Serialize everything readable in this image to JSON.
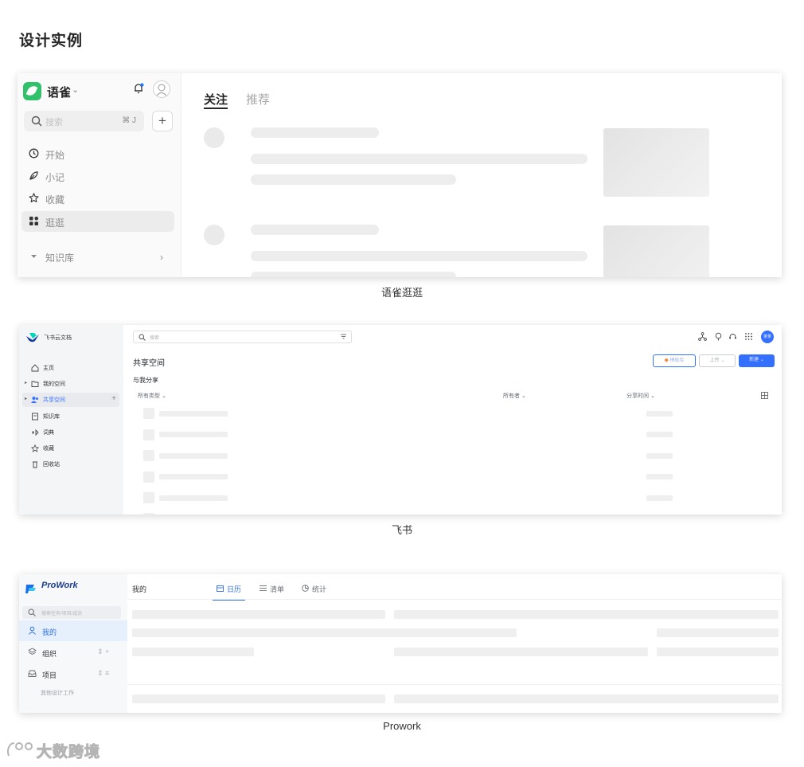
{
  "page": {
    "heading": "设计实例"
  },
  "yuque": {
    "brand": "语雀",
    "search_placeholder": "搜索",
    "search_shortcut": "⌘ J",
    "nav": [
      {
        "label": "开始",
        "icon": "clock-icon"
      },
      {
        "label": "小记",
        "icon": "feather-icon"
      },
      {
        "label": "收藏",
        "icon": "star-icon"
      },
      {
        "label": "逛逛",
        "icon": "grid-icon",
        "active": true
      }
    ],
    "section": "知识库",
    "tabs": [
      {
        "label": "关注",
        "active": true
      },
      {
        "label": "推荐"
      }
    ],
    "caption": "语雀逛逛"
  },
  "feishu": {
    "brand": "飞书云文档",
    "search_placeholder": "搜索",
    "nav": [
      {
        "label": "主页",
        "icon": "home-icon"
      },
      {
        "label": "我的空间",
        "icon": "folder-icon"
      },
      {
        "label": "共享空间",
        "icon": "users-icon",
        "active": true
      },
      {
        "label": "知识库",
        "icon": "book-icon"
      },
      {
        "label": "词典",
        "icon": "dictionary-icon"
      },
      {
        "label": "收藏",
        "icon": "star-icon"
      },
      {
        "label": "回收站",
        "icon": "trash-icon"
      }
    ],
    "page_title": "共享空间",
    "section_title": "与我分享",
    "buttons": {
      "template": "模板库",
      "upload": "上传",
      "create": "新建"
    },
    "columns": {
      "type": "所有类型",
      "owner": "所有者",
      "time": "分享时间"
    },
    "avatar_text": "茶茶",
    "caption": "飞书"
  },
  "prowork": {
    "brand": "ProWork",
    "search_placeholder": "搜索任务/项目/成员",
    "nav": [
      {
        "label": "我的",
        "icon": "user-icon",
        "active": true
      },
      {
        "label": "组织",
        "icon": "layers-icon",
        "tools": "⇕  +"
      },
      {
        "label": "项目",
        "icon": "inbox-icon",
        "tools": "⇕  ≡"
      }
    ],
    "group_label": "其他设计工作",
    "page_title": "我的",
    "tabs": [
      {
        "label": "日历",
        "icon": "calendar-icon",
        "active": true
      },
      {
        "label": "清单",
        "icon": "list-icon"
      },
      {
        "label": "统计",
        "icon": "pie-chart-icon"
      }
    ],
    "caption": "Prowork"
  },
  "watermark": "大数跨境",
  "colors": {
    "yuque_green": "#31c16b",
    "feishu_blue": "#3370ff",
    "prowork_blue": "#2f6fe0"
  }
}
